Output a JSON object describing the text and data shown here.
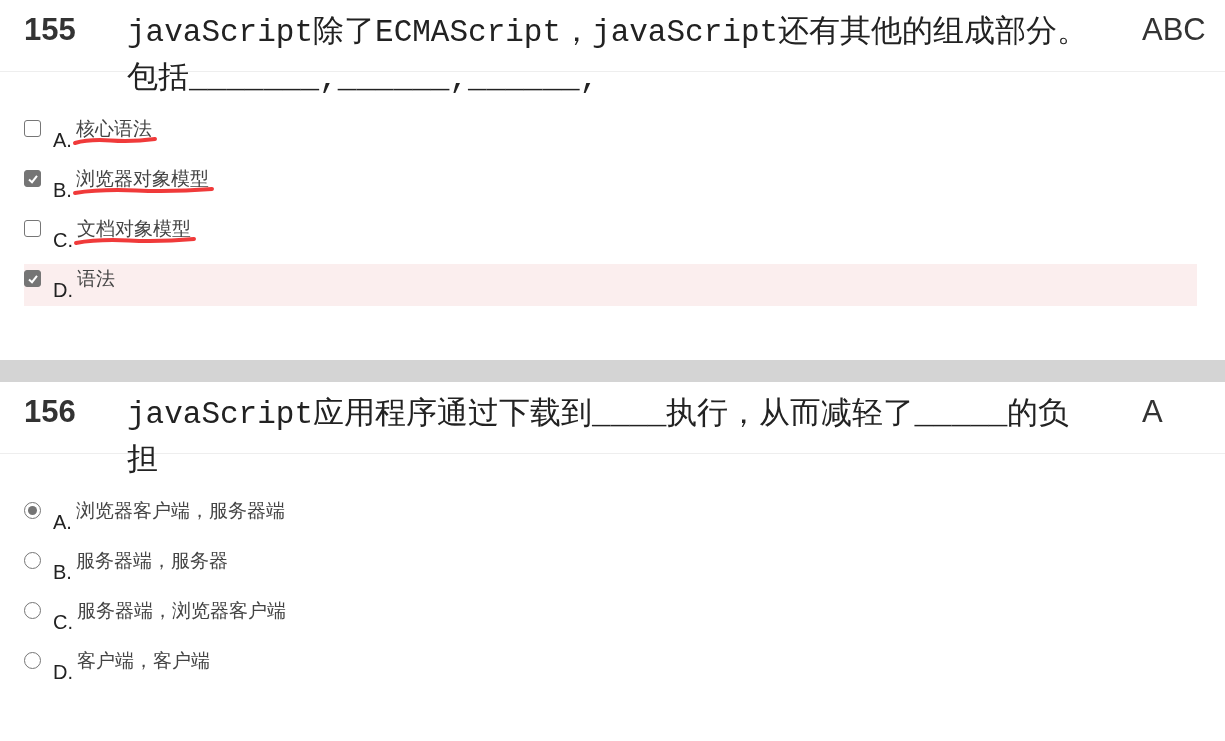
{
  "questions": [
    {
      "number": "155",
      "text": "javaScript除了ECMAScript，javaScript还有其他的组成部分。包括_______,______,______,",
      "answer": "ABC",
      "options": [
        {
          "kind": "checkbox",
          "letter": "A.",
          "label": "核心语法",
          "checked": false,
          "underlined": true,
          "highlighted": false
        },
        {
          "kind": "checkbox",
          "letter": "B.",
          "label": "浏览器对象模型",
          "checked": true,
          "underlined": true,
          "highlighted": false
        },
        {
          "kind": "checkbox",
          "letter": "C.",
          "label": "文档对象模型",
          "checked": false,
          "underlined": true,
          "highlighted": false
        },
        {
          "kind": "checkbox",
          "letter": "D.",
          "label": "语法",
          "checked": true,
          "underlined": false,
          "highlighted": true
        }
      ]
    },
    {
      "number": "156",
      "text": "javaScript应用程序通过下载到____执行，从而减轻了_____的负担",
      "answer": "A",
      "options": [
        {
          "kind": "radio",
          "letter": "A.",
          "label": "浏览器客户端，服务器端",
          "checked": true,
          "underlined": false,
          "highlighted": false
        },
        {
          "kind": "radio",
          "letter": "B.",
          "label": "服务器端，服务器",
          "checked": false,
          "underlined": false,
          "highlighted": false
        },
        {
          "kind": "radio",
          "letter": "C.",
          "label": "服务器端，浏览器客户端",
          "checked": false,
          "underlined": false,
          "highlighted": false
        },
        {
          "kind": "radio",
          "letter": "D.",
          "label": "客户端，客户端",
          "checked": false,
          "underlined": false,
          "highlighted": false
        }
      ]
    }
  ]
}
